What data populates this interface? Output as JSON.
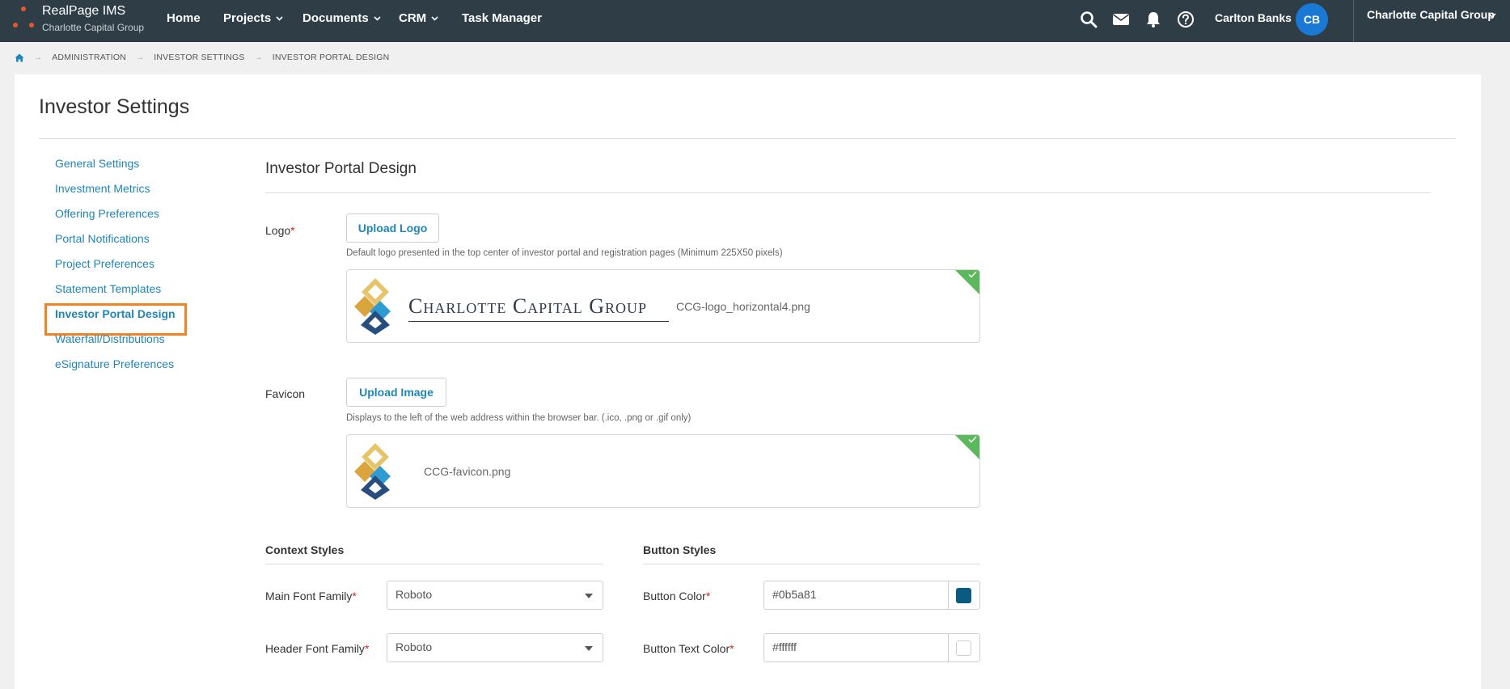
{
  "header": {
    "app_name": "RealPage IMS",
    "company_sub": "Charlotte Capital Group",
    "nav": [
      {
        "label": "Home",
        "has_menu": false
      },
      {
        "label": "Projects",
        "has_menu": true
      },
      {
        "label": "Documents",
        "has_menu": true
      },
      {
        "label": "CRM",
        "has_menu": true
      },
      {
        "label": "Task Manager",
        "has_menu": false
      }
    ],
    "icons": [
      "search-icon",
      "mail-icon",
      "bell-icon",
      "help-icon"
    ],
    "user_name": "Carlton Banks",
    "avatar_initials": "CB",
    "company_switcher": "Charlotte Capital Group",
    "colors": {
      "bar": "#2f3d47",
      "avatar": "#1b79d6",
      "brand_dots": "#e8552e"
    }
  },
  "breadcrumb": [
    "ADMINISTRATION",
    "INVESTOR SETTINGS",
    "INVESTOR PORTAL DESIGN"
  ],
  "page": {
    "title": "Investor Settings",
    "side_nav": [
      "General Settings",
      "Investment Metrics",
      "Offering Preferences",
      "Portal Notifications",
      "Project Preferences",
      "Statement Templates",
      "Investor Portal Design",
      "Waterfall/Distributions",
      "eSignature Preferences"
    ],
    "side_nav_active": "Investor Portal Design",
    "highlight_color": "#f58220",
    "link_color": "#1f86b6"
  },
  "design": {
    "section_title": "Investor Portal Design",
    "logo": {
      "label": "Logo",
      "required": "*",
      "button": "Upload Logo",
      "help": "Default logo presented in the top center of investor portal and registration pages (Minimum 225X50 pixels)",
      "logo_text": "Charlotte Capital Group",
      "file_name": "CCG-logo_horizontal4.png"
    },
    "favicon": {
      "label": "Favicon",
      "button": "Upload Image",
      "help": "Displays to the left of the web address within the browser bar. (.ico, .png or .gif only)",
      "file_name": "CCG-favicon.png"
    },
    "context_styles": {
      "heading": "Context Styles",
      "main_font_label": "Main Font Family",
      "main_font_value": "Roboto",
      "header_font_label": "Header Font Family",
      "header_font_value": "Roboto"
    },
    "button_styles": {
      "heading": "Button Styles",
      "button_color_label": "Button Color",
      "button_color_value": "#0b5a81",
      "button_text_color_label": "Button Text Color",
      "button_text_color_value": "#ffffff"
    },
    "required_mark": "*"
  }
}
